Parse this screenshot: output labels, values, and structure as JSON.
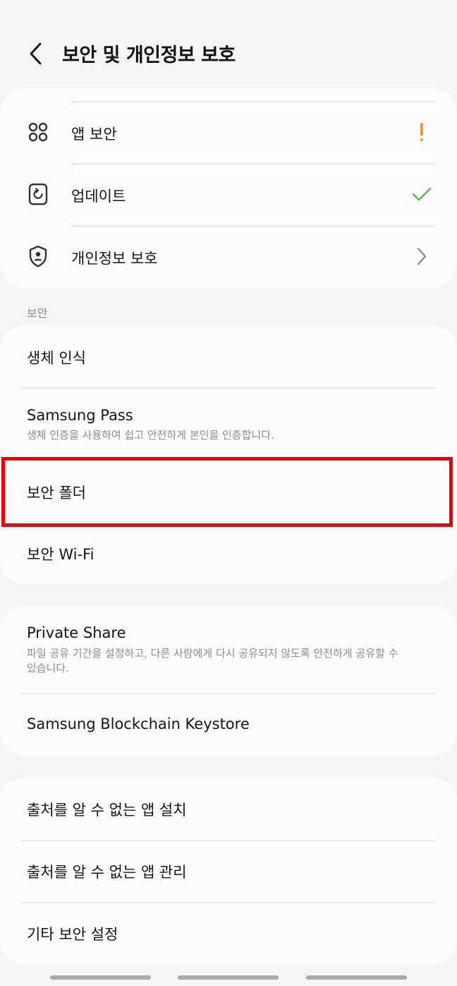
{
  "header": {
    "title": "보안 및 개인정보 보호"
  },
  "colors": {
    "warning": "#f1972f",
    "ok": "#5cb85c",
    "highlight": "#f20000"
  },
  "status_items": [
    {
      "label": "앱 보안",
      "icon": "apps-grid-icon",
      "status": "warning"
    },
    {
      "label": "업데이트",
      "icon": "update-icon",
      "status": "ok"
    },
    {
      "label": "개인정보 보호",
      "icon": "privacy-shield-icon",
      "status": "chevron"
    }
  ],
  "security_section": {
    "header": "보안",
    "items": [
      {
        "label": "생체 인식"
      },
      {
        "label": "Samsung Pass",
        "subtitle": "생체 인증을 사용하여 쉽고 안전하게 본인을 인증합니다."
      },
      {
        "label": "보안 폴더"
      },
      {
        "label": "보안 Wi-Fi"
      }
    ]
  },
  "share_items": [
    {
      "label": "Private Share",
      "subtitle_line1": "파일 공유 기간을 설정하고, 다른 사람에게 다시 공유되지 않도록 안전하게 공유할 수",
      "subtitle_line2": "있습니다."
    },
    {
      "label": "Samsung Blockchain Keystore"
    }
  ],
  "other_items": [
    {
      "label": "출처를 알 수 없는 앱 설치"
    },
    {
      "label": "출처를 알 수 없는 앱 관리"
    },
    {
      "label": "기타 보안 설정"
    }
  ]
}
